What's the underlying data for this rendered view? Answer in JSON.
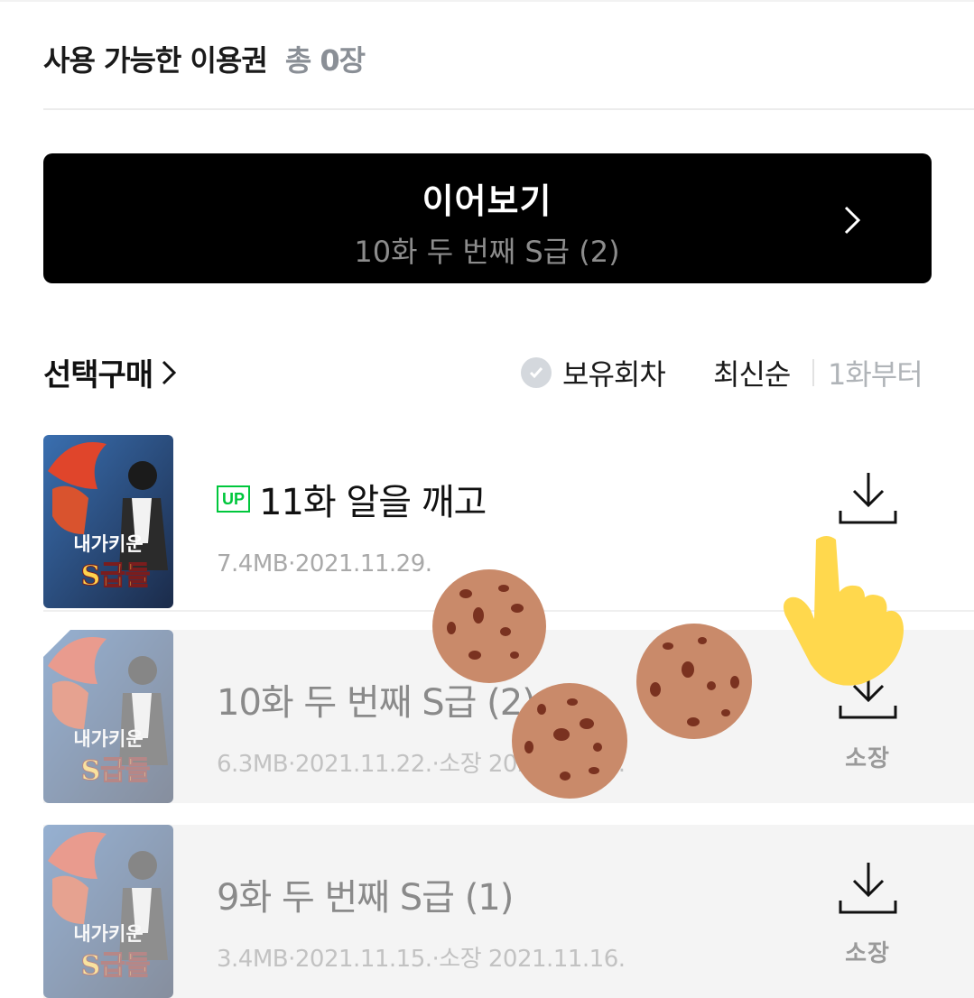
{
  "header": {
    "ticket_label": "사용 가능한 이용권",
    "ticket_count": "총 0장"
  },
  "continue": {
    "title": "이어보기",
    "subtitle": "10화 두 번째 S급 (2)"
  },
  "purchase": {
    "label": "선택구매",
    "owned_filter": "보유회차",
    "sort_latest": "최신순",
    "sort_first": "1화부터"
  },
  "episodes": [
    {
      "badge": "UP",
      "title": "11화 알을 깨고",
      "meta": "7.4MB·2021.11.29.",
      "status": ""
    },
    {
      "badge": "",
      "title": "10화 두 번째 S급 (2)",
      "meta": "6.3MB·2021.11.22.·소장 2021.11.22.",
      "status": "소장"
    },
    {
      "badge": "",
      "title": "9화 두 번째 S급 (1)",
      "meta": "3.4MB·2021.11.15.·소장 2021.11.16.",
      "status": "소장"
    }
  ],
  "cover_text": {
    "line1": "내가키운",
    "line2": "S급들"
  },
  "colors": {
    "accent_green": "#00c73c",
    "cookie": "#c98a6a",
    "hand": "#ffd84d",
    "button_bg": "#000000"
  }
}
